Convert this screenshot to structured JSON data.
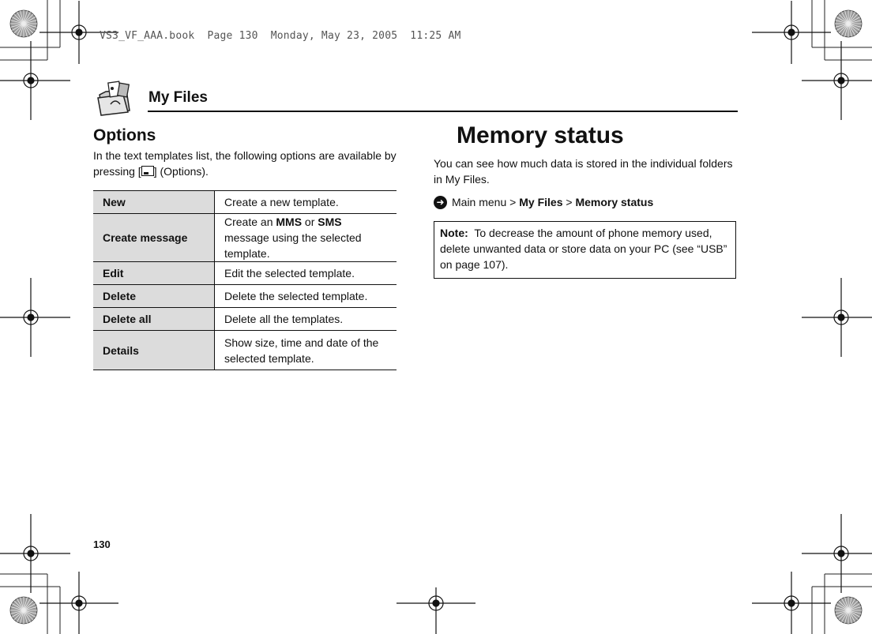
{
  "slug": "VS3_VF_AAA.book  Page 130  Monday, May 23, 2005  11:25 AM",
  "chapter": {
    "title": "My Files",
    "icon": "folder-files-icon"
  },
  "options": {
    "heading": "Options",
    "intro_before": "In the text templates list, the following options are available by pressing [",
    "intro_key_icon": "left-softkey-icon",
    "intro_after": "] (Options).",
    "rows": [
      {
        "key": "New",
        "desc": "Create a new template."
      },
      {
        "key": "Create message",
        "desc_parts": [
          "Create an ",
          "MMS",
          " or ",
          "SMS",
          " message using the selected template."
        ]
      },
      {
        "key": "Edit",
        "desc": "Edit the selected template."
      },
      {
        "key": "Delete",
        "desc": "Delete the selected template."
      },
      {
        "key": "Delete all",
        "desc": "Delete all the templates."
      },
      {
        "key": "Details",
        "desc": "Show size, time and date of the selected template."
      }
    ]
  },
  "memory_status": {
    "heading": "Memory status",
    "intro": "You can see how much data is stored in the individual folders in My Files.",
    "nav_icon": "arrow-right-circle-icon",
    "nav": {
      "prefix": "Main menu",
      "sep": " > ",
      "step1": "My Files",
      "step2": "Memory status"
    },
    "note": {
      "label": "Note:",
      "text": "To decrease the amount of phone memory used, delete unwanted data or store data on your PC (see “USB” on page 107)."
    }
  },
  "page_number": "130",
  "colors": {
    "table_key_bg": "#dcdcdc",
    "text": "#111111"
  }
}
